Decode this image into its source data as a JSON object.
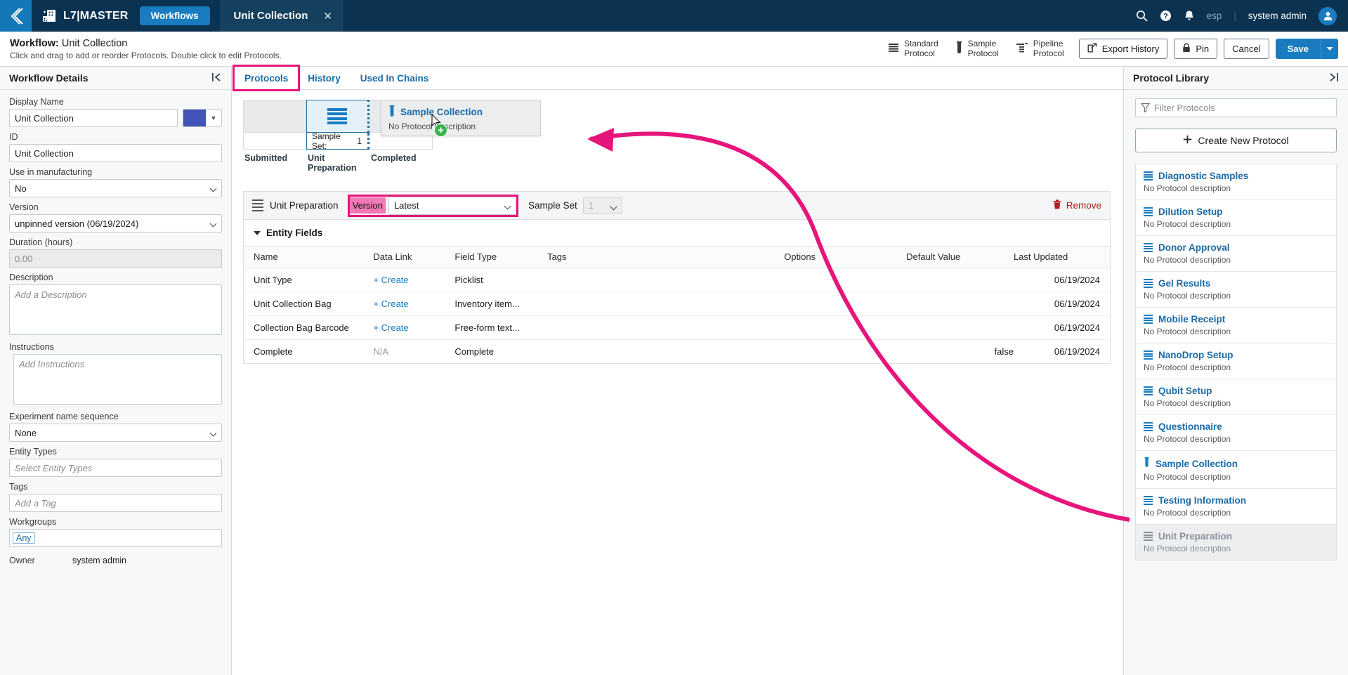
{
  "topnav": {
    "back_icon": "chevron-left-icon",
    "brand": "L7|MASTER",
    "brand_icon": "building-icon",
    "nav_tab": "Workflows",
    "doc_tab": "Unit Collection",
    "close_icon": "close-icon",
    "search_icon": "search-icon",
    "help_icon": "help-icon",
    "bell_icon": "notification-icon",
    "language": "esp",
    "separator": "|",
    "user": "system admin",
    "avatar_icon": "user-avatar-icon"
  },
  "header": {
    "title_prefix": "Workflow:",
    "title_value": "Unit Collection",
    "subtitle": "Click and drag to add or reorder Protocols. Double click to edit Protocols.",
    "protocol_types": [
      {
        "line1": "Standard",
        "line2": "Protocol",
        "icon": "stack-icon"
      },
      {
        "line1": "Sample",
        "line2": "Protocol",
        "icon": "vial-icon"
      },
      {
        "line1": "Pipeline",
        "line2": "Protocol",
        "icon": "pipeline-icon"
      }
    ],
    "export_history": "Export History",
    "export_icon": "external-link-icon",
    "pin": "Pin",
    "pin_icon": "lock-icon",
    "cancel": "Cancel",
    "save": "Save",
    "save_caret_icon": "chevron-down-icon"
  },
  "left_panel": {
    "title": "Workflow Details",
    "collapse_icon": "collapse-left-icon",
    "fields": {
      "display_name_label": "Display Name",
      "display_name_value": "Unit Collection",
      "color_value": "#4253ba",
      "color_caret_icon": "caret-down-icon",
      "id_label": "ID",
      "id_value": "Unit Collection",
      "use_manufacturing_label": "Use in manufacturing",
      "use_manufacturing_value": "No",
      "version_label": "Version",
      "version_value": "unpinned version (06/19/2024)",
      "duration_label": "Duration (hours)",
      "duration_value": "0.00",
      "description_label": "Description",
      "description_placeholder": "Add a Description",
      "instructions_label": "Instructions",
      "instructions_placeholder": "Add Instructions",
      "exp_seq_label": "Experiment name sequence",
      "exp_seq_value": "None",
      "entity_types_label": "Entity Types",
      "entity_types_placeholder": "Select Entity Types",
      "tags_label": "Tags",
      "tags_placeholder": "Add a Tag",
      "workgroups_label": "Workgroups",
      "workgroups_chip": "Any",
      "owner_label": "Owner",
      "owner_value": "system admin"
    }
  },
  "center": {
    "tabs": [
      {
        "label": "Protocols",
        "active": true
      },
      {
        "label": "History",
        "active": false
      },
      {
        "label": "Used In Chains",
        "active": false
      }
    ],
    "chain": {
      "stages": [
        "Submitted",
        "Unit Preparation",
        "Completed"
      ],
      "sample_set_key": "Sample Set:",
      "sample_set_value": "1",
      "node_icon": "stack-icon"
    },
    "drag_ghost": {
      "title": "Sample Collection",
      "subtitle": "No Protocol description",
      "icon": "vial-icon",
      "badge_icon": "plus-circle-icon",
      "cursor_icon": "cursor-arrow-icon"
    },
    "protocol_bar": {
      "icon": "stack-icon",
      "name": "Unit Preparation",
      "version_label": "Version",
      "version_value": "Latest",
      "sample_set_label": "Sample Set",
      "sample_set_value": "1",
      "remove_label": "Remove",
      "remove_icon": "trash-icon"
    },
    "entity_fields": {
      "section_title": "Entity Fields",
      "caret_icon": "caret-down-icon",
      "columns": [
        "Name",
        "Data Link",
        "Field Type",
        "Tags",
        "Options",
        "Default Value",
        "Last Updated"
      ],
      "rows": [
        {
          "name": "Unit Type",
          "data_link": "+ Create",
          "data_link_type": "create",
          "field_type": "Picklist",
          "tags": "",
          "options": "",
          "default_value": "",
          "last_updated": "06/19/2024"
        },
        {
          "name": "Unit Collection Bag",
          "data_link": "+ Create",
          "data_link_type": "create",
          "field_type": "Inventory item...",
          "tags": "",
          "options": "",
          "default_value": "",
          "last_updated": "06/19/2024"
        },
        {
          "name": "Collection Bag Barcode",
          "data_link": "+ Create",
          "data_link_type": "create",
          "field_type": "Free-form text...",
          "tags": "",
          "options": "",
          "default_value": "",
          "last_updated": "06/19/2024"
        },
        {
          "name": "Complete",
          "data_link": "N/A",
          "data_link_type": "na",
          "field_type": "Complete",
          "tags": "",
          "options": "",
          "default_value": "false",
          "last_updated": "06/19/2024"
        }
      ]
    }
  },
  "right_panel": {
    "title": "Protocol Library",
    "expand_icon": "collapse-right-icon",
    "filter_placeholder": "Filter Protocols",
    "filter_icon": "funnel-icon",
    "create_new": "Create New Protocol",
    "create_icon": "plus-icon",
    "no_description": "No Protocol description",
    "items": [
      {
        "name": "Diagnostic Samples",
        "icon": "stack-icon",
        "disabled": false
      },
      {
        "name": "Dilution Setup",
        "icon": "stack-icon",
        "disabled": false
      },
      {
        "name": "Donor Approval",
        "icon": "stack-icon",
        "disabled": false
      },
      {
        "name": "Gel Results",
        "icon": "stack-icon",
        "disabled": false
      },
      {
        "name": "Mobile Receipt",
        "icon": "stack-icon",
        "disabled": false
      },
      {
        "name": "NanoDrop Setup",
        "icon": "stack-icon",
        "disabled": false
      },
      {
        "name": "Qubit Setup",
        "icon": "stack-icon",
        "disabled": false
      },
      {
        "name": "Questionnaire",
        "icon": "stack-icon",
        "disabled": false
      },
      {
        "name": "Sample Collection",
        "icon": "vial-icon",
        "disabled": false
      },
      {
        "name": "Testing Information",
        "icon": "stack-icon",
        "disabled": false
      },
      {
        "name": "Unit Preparation",
        "icon": "stack-icon",
        "disabled": true
      }
    ]
  },
  "annotations": {
    "accent_color": "#e6157b",
    "highlight_boxes": [
      "protocols-tab",
      "version-label-select"
    ],
    "arrow": "curved-arrow-from-sample-collection-library-to-canvas"
  }
}
